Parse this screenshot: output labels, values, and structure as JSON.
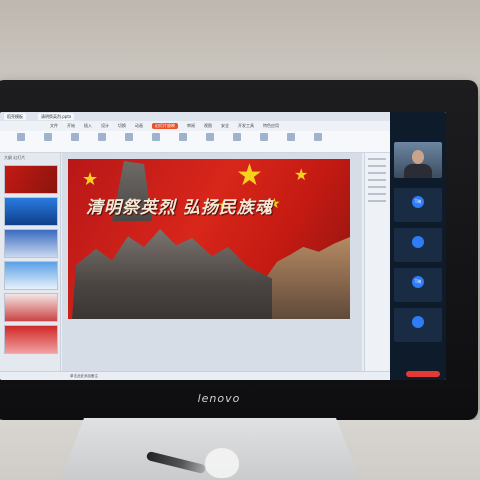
{
  "window": {
    "tabs": [
      "稻壳模板",
      "清明祭英烈.pptx"
    ],
    "title_badge": "",
    "menu": [
      "文件",
      "开始",
      "插入",
      "设计",
      "切换",
      "动画",
      "幻灯片放映",
      "审阅",
      "视图",
      "安全",
      "开发工具",
      "特色应用"
    ],
    "active_menu": "幻灯片放映"
  },
  "slide": {
    "title": "清明祭英烈 弘扬民族魂"
  },
  "panel": {
    "thumb_header": "大纲  幻灯片",
    "thumb_count": 6
  },
  "participants": [
    {
      "avatar": "T晓",
      "name": ""
    },
    {
      "avatar": "",
      "name": ""
    },
    {
      "avatar": "T晓",
      "name": ""
    },
    {
      "avatar": "",
      "name": ""
    }
  ],
  "statusbar": {
    "note": "单击此处添加备注",
    "zoom": ""
  },
  "device": {
    "brand": "lenovo"
  },
  "colors": {
    "slide_red": "#c41a12",
    "star_yellow": "#f6d21c",
    "accent_green": "#2f7d63",
    "end_call": "#e53935"
  }
}
